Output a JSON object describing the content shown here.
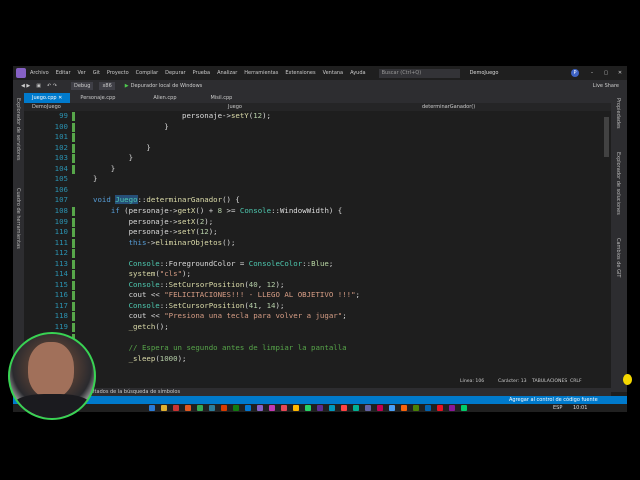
{
  "menu": {
    "items": [
      "Archivo",
      "Editar",
      "Ver",
      "Git",
      "Proyecto",
      "Compilar",
      "Depurar",
      "Prueba",
      "Analizar",
      "Herramientas",
      "Extensiones",
      "Ventana",
      "Ayuda"
    ],
    "search_placeholder": "Buscar (Ctrl+Q)",
    "solution": "DemoJuego",
    "avatar": "P"
  },
  "toolbar": {
    "config": "Debug",
    "platform": "x86",
    "run": "Depurador local de Windows",
    "live_share": "Live Share"
  },
  "left_panels": [
    "Explorador de servidores",
    "Cuadro de herramientas"
  ],
  "right_panels": [
    "Propiedades",
    "Explorador de soluciones",
    "Cambios de GIT"
  ],
  "tabs": [
    "Juego.cpp",
    "Personaje.cpp",
    "Alien.cpp",
    "Misil.cpp"
  ],
  "nav": {
    "project": "DemoJuego",
    "scope": "Juego",
    "member": "determinarGanador()"
  },
  "code_lines": [
    {
      "n": "99",
      "text": "                    personaje->setY(12);"
    },
    {
      "n": "100",
      "text": "                }"
    },
    {
      "n": "101",
      "text": ""
    },
    {
      "n": "102",
      "text": "            }"
    },
    {
      "n": "103",
      "text": "        }"
    },
    {
      "n": "104",
      "text": "    }"
    },
    {
      "n": "105",
      "text": "}"
    },
    {
      "n": "106",
      "text": ""
    },
    {
      "n": "107",
      "text": "void Juego::determinarGanador() {"
    },
    {
      "n": "108",
      "text": "    if (personaje->getX() + 8 >= Console::WindowWidth) {"
    },
    {
      "n": "109",
      "text": "        personaje->setX(2);"
    },
    {
      "n": "110",
      "text": "        personaje->setY(12);"
    },
    {
      "n": "111",
      "text": "        this->eliminarObjetos();"
    },
    {
      "n": "112",
      "text": ""
    },
    {
      "n": "113",
      "text": "        Console::ForegroundColor = ConsoleColor::Blue;"
    },
    {
      "n": "114",
      "text": "        system(\"cls\");"
    },
    {
      "n": "115",
      "text": "        Console::SetCursorPosition(40, 12);"
    },
    {
      "n": "116",
      "text": "        cout << \"FELICITACIONES!!! - LLEGO AL OBJETIVO !!!\";"
    },
    {
      "n": "117",
      "text": "        Console::SetCursorPosition(41, 14);"
    },
    {
      "n": "118",
      "text": "        cout << \"Presiona una tecla para volver a jugar\";"
    },
    {
      "n": "119",
      "text": "        _getch();"
    },
    {
      "n": "120",
      "text": ""
    },
    {
      "n": "121",
      "text": "        // Espera un segundo antes de limpiar la pantalla"
    },
    {
      "n": "122",
      "text": "        _sleep(1000);"
    }
  ],
  "status": {
    "line": "Línea: 106",
    "char": "Carácter: 13",
    "tabs": "TABULACIONES",
    "eol": "CRLF",
    "panel": "ultados de la búsqueda de símbolos",
    "source_control": "Agregar al control de código fuente"
  },
  "taskbar": {
    "lang": "ESP",
    "time": "10:01"
  },
  "colors": {
    "accent": "#007acc",
    "webcam_ring": "#39d353",
    "change_bar": "#57a64a"
  }
}
